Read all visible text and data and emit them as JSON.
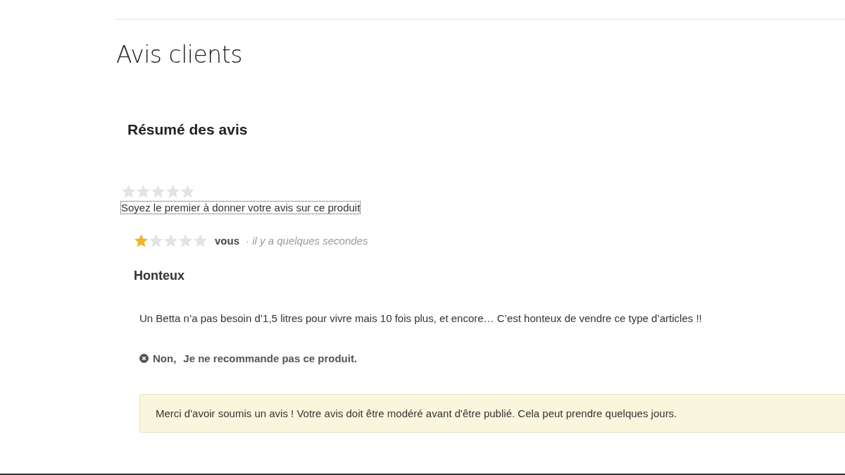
{
  "title": "Avis clients",
  "summary": {
    "heading": "Résumé des avis",
    "stars": 0,
    "link": "Soyez le premier à donner votre avis sur ce produit"
  },
  "reviews": [
    {
      "stars": 1,
      "author": "vous",
      "time": "· il y a quelques secondes",
      "title": "Honteux",
      "body": "Un Betta n’a pas besoin d’1,5 litres pour vivre mais 10 fois plus, et encore… C’est honteux de vendre ce type d’articles !!",
      "recommend": {
        "recommended": false,
        "answer": "Non,",
        "text": "Je ne recommande pas ce produit."
      }
    }
  ],
  "notice": "Merci d'avoir soumis un avis ! Votre avis doit être modéré avant d'être publié. Cela peut prendre quelques jours."
}
